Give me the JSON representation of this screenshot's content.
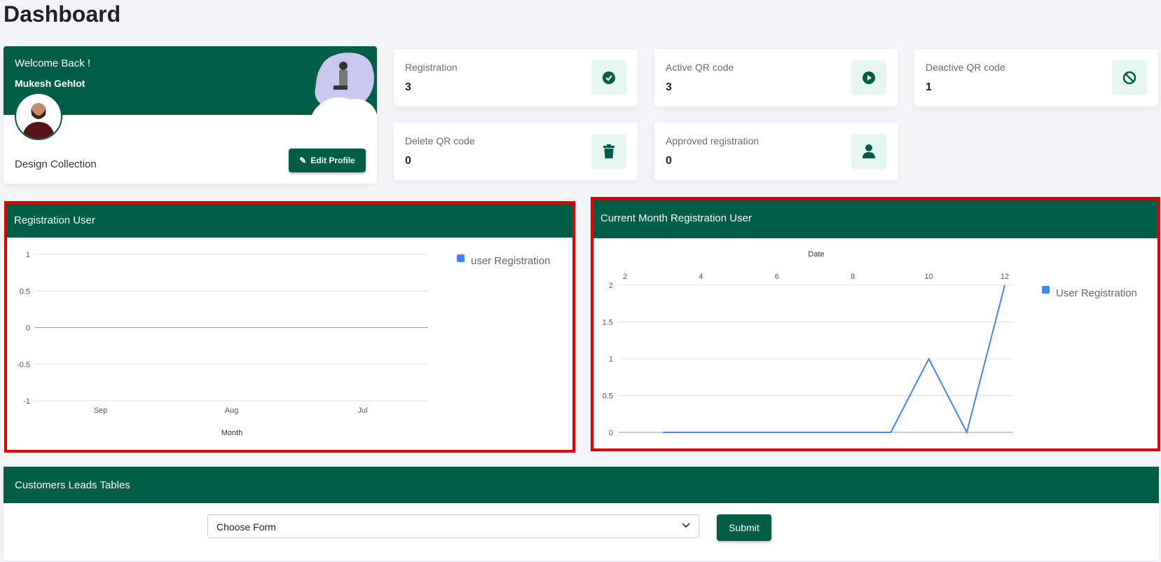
{
  "page_title": "Dashboard",
  "profile": {
    "welcome": "Welcome Back !",
    "name": "Mukesh Gehlot",
    "company": "Design Collection",
    "edit_label": "Edit Profile"
  },
  "stats": [
    {
      "label": "Registration",
      "value": "3",
      "icon": "check-circle-icon"
    },
    {
      "label": "Active QR code",
      "value": "3",
      "icon": "play-circle-icon"
    },
    {
      "label": "Deactive QR code",
      "value": "1",
      "icon": "ban-icon"
    },
    {
      "label": "Delete QR code",
      "value": "0",
      "icon": "trash-icon"
    },
    {
      "label": "Approved registration",
      "value": "0",
      "icon": "user-icon"
    }
  ],
  "colors": {
    "brand": "#005e47",
    "series": "#4285f4",
    "highlight": "#e30000"
  },
  "chart_data": [
    {
      "type": "line",
      "title": "Registration User",
      "xlabel": "Month",
      "categories": [
        "Sep",
        "Aug",
        "Jul"
      ],
      "series": [
        {
          "name": "user Registration",
          "values": []
        }
      ],
      "ylim": [
        -1,
        1
      ],
      "yticks": [
        "1",
        "0.5",
        "0",
        "-0.5",
        "-1"
      ],
      "grid": true,
      "legend": "right"
    },
    {
      "type": "line",
      "title": "Current Month Registration User",
      "xlabel": "Date",
      "x_axis_position": "top",
      "xticks": [
        "2",
        "4",
        "6",
        "8",
        "10",
        "12"
      ],
      "xlim": [
        2,
        12
      ],
      "yticks": [
        "2",
        "1.5",
        "1",
        "0.5",
        "0"
      ],
      "ylim": [
        0,
        2
      ],
      "series": [
        {
          "name": "User Registration",
          "x": [
            3,
            4,
            5,
            6,
            7,
            8,
            9,
            10,
            11,
            12
          ],
          "values": [
            0,
            0,
            0,
            0,
            0,
            0,
            0,
            1,
            0,
            2
          ]
        }
      ],
      "grid": true,
      "legend": "right"
    }
  ],
  "leads": {
    "title": "Customers Leads Tables",
    "select_value": "Choose Form",
    "submit_label": "Submit"
  }
}
